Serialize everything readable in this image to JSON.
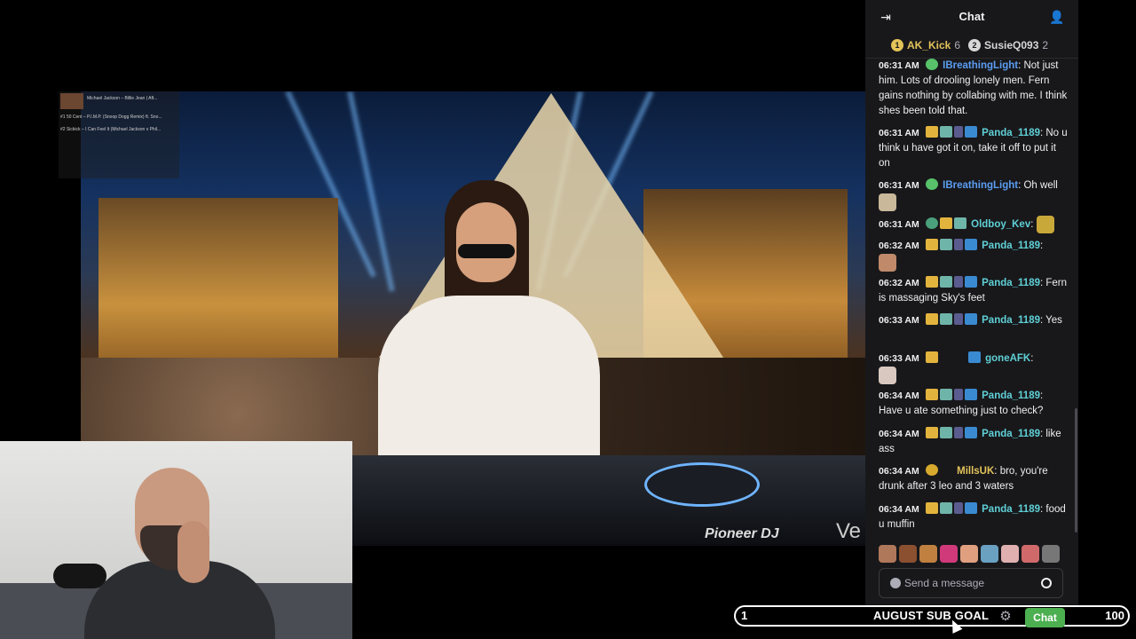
{
  "chat": {
    "title": "Chat",
    "leaderboard": [
      {
        "rank": "1",
        "name": "AK_Kick",
        "count": "6",
        "color": "#e3c35a"
      },
      {
        "rank": "2",
        "name": "SusieQ093",
        "count": "2",
        "color": "#d7d7d7"
      }
    ],
    "messages": [
      {
        "time": "06:31 AM",
        "user": "IBreathingLight",
        "color": "#5b9df1",
        "text": "Not just him. Lots of drooling lonely men. Fern gains nothing by collabing with me. I think shes been told that."
      },
      {
        "time": "06:31 AM",
        "user": "Panda_1189",
        "color": "#5fd0d6",
        "text": "No u think u have got it on, take it off to put it on"
      },
      {
        "time": "06:31 AM",
        "user": "IBreathingLight",
        "color": "#5b9df1",
        "text": "Oh well"
      },
      {
        "time": "06:31 AM",
        "user": "Oldboy_Kev",
        "color": "#5fd0d6",
        "text": ""
      },
      {
        "time": "06:32 AM",
        "user": "Panda_1189",
        "color": "#5fd0d6",
        "text": ""
      },
      {
        "time": "06:32 AM",
        "user": "Panda_1189",
        "color": "#5fd0d6",
        "text": "Fern is massaging Sky's feet"
      },
      {
        "time": "06:33 AM",
        "user": "Panda_1189",
        "color": "#5fd0d6",
        "text": "Yes"
      },
      {
        "time": "06:33 AM",
        "user": "goneAFK",
        "color": "#5fd0d6",
        "text": ""
      },
      {
        "time": "06:34 AM",
        "user": "Panda_1189",
        "color": "#5fd0d6",
        "text": "Have u ate something just to check?"
      },
      {
        "time": "06:34 AM",
        "user": "Panda_1189",
        "color": "#5fd0d6",
        "text": "like ass"
      },
      {
        "time": "06:34 AM",
        "user": "MillsUK",
        "color": "#e3c35a",
        "text": "bro, you're drunk after 3 leo and 3 waters"
      },
      {
        "time": "06:34 AM",
        "user": "Panda_1189",
        "color": "#5fd0d6",
        "text": "food u muffin"
      }
    ],
    "input_placeholder": "Send a message"
  },
  "music_overlay": {
    "now_playing": "Michael Jackson – Billie Jean | Aft...",
    "rows": [
      {
        "rank": "#1",
        "title": "50 Cent – P.I.M.P. (Snoop Dogg Remix) ft. Sno..."
      },
      {
        "rank": "#2",
        "title": "Sickick – I Can Feel It (Michael Jackson x Phil..."
      }
    ]
  },
  "video": {
    "brand": "Pioneer DJ",
    "brand_partial": "Ve"
  },
  "goal": {
    "current": "1",
    "label": "AUGUST SUB GOAL",
    "target": "100"
  },
  "chat_button_label": "Chat",
  "icons": {
    "collapse": "collapse-chat-icon",
    "users": "users-icon",
    "settings": "gear-icon",
    "emote": "smiley-icon",
    "shield": "shield-icon"
  },
  "colors": {
    "chat_bg": "#18181b",
    "chat_button": "#4caf50",
    "text": "#efeff1"
  }
}
